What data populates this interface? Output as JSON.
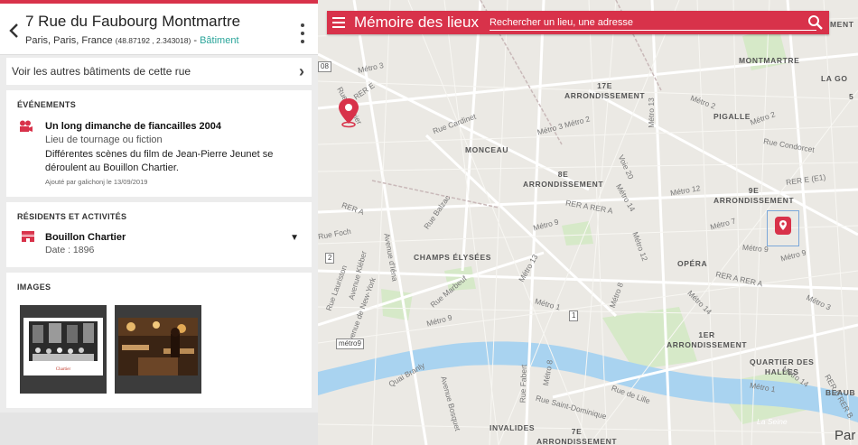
{
  "colors": {
    "accent": "#d8324a",
    "link": "#2aa59a"
  },
  "place": {
    "title": "7 Rue du Faubourg Montmartre",
    "location": "Paris, Paris, France",
    "coords": "(48.87192 , 2.343018)",
    "separator": " - ",
    "type": "Bâtiment"
  },
  "street_link": {
    "label": "Voir les autres bâtiments de cette rue"
  },
  "events": {
    "heading": "ÉVÉNEMENTS",
    "icon": "film-camera-icon",
    "name": "Un long dimanche de fiancailles 2004",
    "type": "Lieu de tournage ou fiction",
    "description": "Différentes scènes du film de Jean-Pierre Jeunet se déroulent au Bouillon Chartier.",
    "added": "Ajouté par galichonj le 13/09/2019"
  },
  "residents": {
    "heading": "RÉSIDENTS ET ACTIVITÉS",
    "icon": "storefront-icon",
    "name": "Bouillon Chartier",
    "date": "Date : 1896"
  },
  "images": {
    "heading": "IMAGES",
    "thumb1_caption": "Chartier"
  },
  "map": {
    "brand": "Mémoire des lieux",
    "search_placeholder": "Rechercher un lieu, une adresse",
    "districts": {
      "montmartre": "MONTMARTRE",
      "la_go": "LA GO",
      "arr17_a": "17E",
      "arr17_b": "ARRONDISSEMENT",
      "pigalle": "PIGALLE",
      "monceau": "MONCEAU",
      "arr8_a": "8E",
      "arr8_b": "ARRONDISSEMENT",
      "arr9_a": "9E",
      "arr9_b": "ARRONDISSEMENT",
      "champs": "CHAMPS ÉLYSÉES",
      "opera": "OPÉRA",
      "arr1_a": "1ER",
      "arr1_b": "ARRONDISSEMENT",
      "quartier_a": "QUARTIER DES",
      "quartier_b": "HALLES",
      "beaub": "BEAUB",
      "invalides": "INVALIDES",
      "arr7_a": "7E",
      "arr7_b": "ARRONDISSEMENT",
      "ment": "MENT",
      "s5": "5"
    },
    "streets": {
      "metro3": "Métro 3",
      "rer_e_left": "RER E",
      "rue_laugier": "Rue Laugier",
      "rue_cardinet": "Rue Cardinet",
      "metro3_2": "Métro 3 Métro 2",
      "metro2": "Métro 2",
      "metro2b": "Métro 2",
      "rue_condorcet": "Rue Condorcet",
      "metro13": "Métro 13",
      "voie20": "Voie 20",
      "metro12": "Métro 12",
      "rer_e_e1": "RER E (E1)",
      "rer_a": "RER A RER A",
      "rer_a2": "RER A",
      "metro9": "Métro 9",
      "metro9b": "Métro 9",
      "metro7": "Métro 7",
      "metro9c": "Métro 9",
      "rue_foch": "Rue Foch",
      "rue_balzac": "Rue Balzac",
      "metro14": "Métro 14",
      "metro12b": "Métro 12",
      "avenue_iena": "Avenue d'Iéna",
      "avenue_kleber": "Avenue Kléber",
      "rue_marbeuf": "Rue Marbeuf",
      "metro13b": "Métro 13",
      "metro1": "Métro 1",
      "metro8": "Métro 8",
      "metro14b": "Métro 14",
      "rer_a3": "RER A RER A",
      "metro3b": "Métro 3",
      "metro9d": "Métro 9",
      "avenue_lauriston": "Rue Lauriston",
      "avenue_new_york": "Avenue de New-York",
      "metro8b": "Métro 8",
      "quai_branly": "Quai Branly",
      "rue_fabert": "Rue Fabert",
      "avenue_bosquet": "Avenue Bosquet",
      "rue_saint_dominique": "Rue Saint-Dominique",
      "rue_de_lille": "Rue de Lille",
      "metro1b": "Métro 1",
      "metro14c": "Métro 14",
      "rer_b": "RER B RER B",
      "la_seine": "La Seine",
      "par": "Par"
    },
    "boxes": {
      "b08": "08",
      "b2": "2",
      "b1": "1",
      "metro9box": "métro9"
    }
  }
}
